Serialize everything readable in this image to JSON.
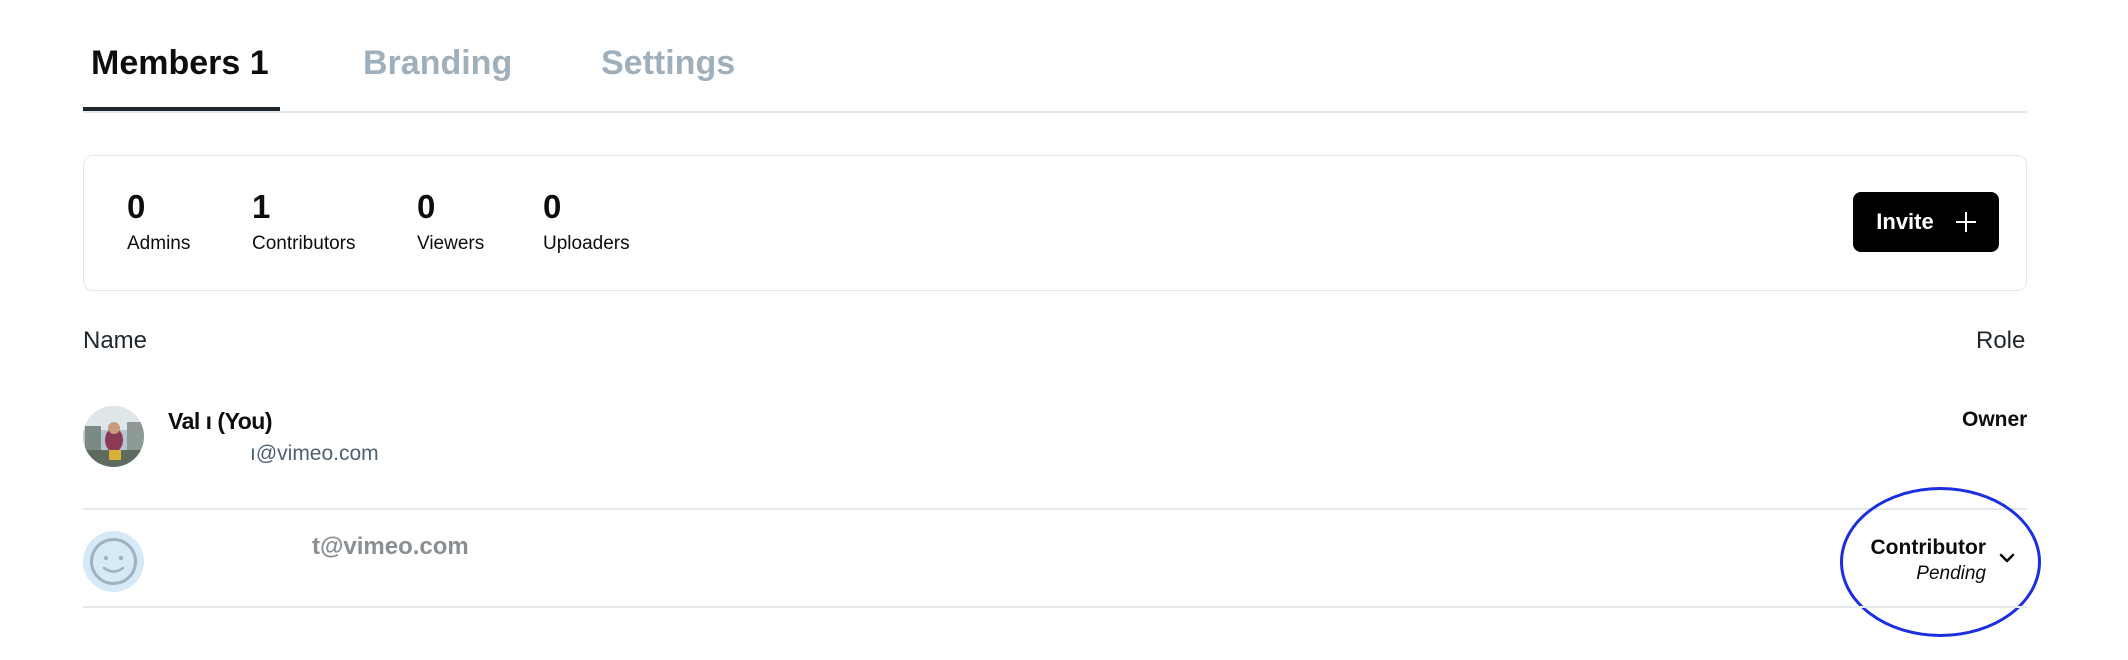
{
  "tabs": [
    {
      "label": "Members 1",
      "active": true
    },
    {
      "label": "Branding",
      "active": false
    },
    {
      "label": "Settings",
      "active": false
    }
  ],
  "stats": [
    {
      "count": "0",
      "label": "Admins"
    },
    {
      "count": "1",
      "label": "Contributors"
    },
    {
      "count": "0",
      "label": "Viewers"
    },
    {
      "count": "0",
      "label": "Uploaders"
    }
  ],
  "invite_button": {
    "label": "Invite",
    "icon": "plus-icon"
  },
  "table": {
    "columns": {
      "name": "Name",
      "role": "Role"
    },
    "members": [
      {
        "name": "Val       ı (You)",
        "email": "ı@vimeo.com",
        "role": "Owner",
        "avatar": "photo"
      },
      {
        "email": "t@vimeo.com",
        "role": "Contributor",
        "status": "Pending",
        "avatar": "placeholder-face-icon"
      }
    ]
  },
  "colors": {
    "active_tab": "#0b0d0f",
    "inactive_tab": "#9fafbb",
    "button_bg": "#000000",
    "highlight": "#1b2ee0",
    "avatar_placeholder": "#d6e9f7"
  }
}
